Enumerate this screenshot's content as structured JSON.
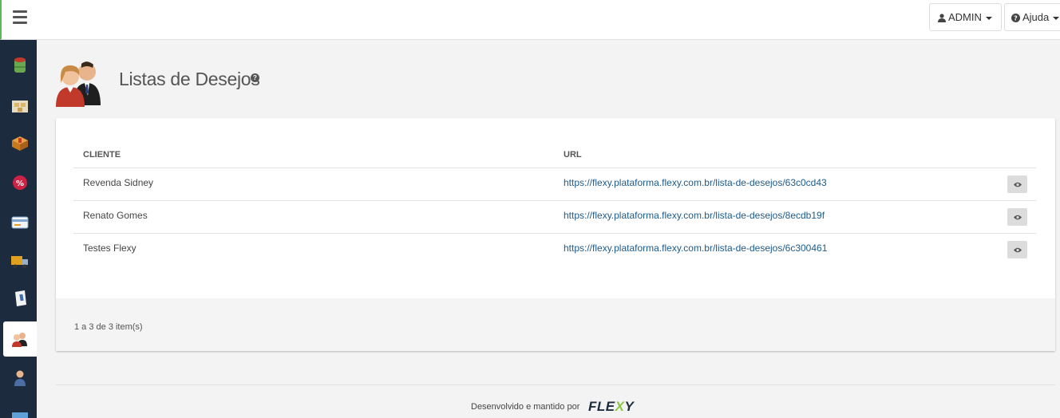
{
  "header": {
    "user_label": "ADMIN",
    "help_label": "Ajuda"
  },
  "sidebar": {
    "items": [
      {
        "icon": "database-icon",
        "color": "#6aa84f"
      },
      {
        "icon": "boxes-icon",
        "color": "#d9b66a"
      },
      {
        "icon": "package-icon",
        "color": "#d08a2c"
      },
      {
        "icon": "discount-icon",
        "color": "#cc2244"
      },
      {
        "icon": "card-icon",
        "color": "#7fa8d0"
      },
      {
        "icon": "truck-icon",
        "color": "#e0a020"
      },
      {
        "icon": "note-icon",
        "color": "#e8e8e8"
      },
      {
        "icon": "users-icon",
        "color": "#c0392b",
        "active": true
      },
      {
        "icon": "person-icon",
        "color": "#4a6fa5"
      },
      {
        "icon": "image-icon",
        "color": "#5fa0d8"
      }
    ]
  },
  "page": {
    "title": "Listas de Desejos"
  },
  "table": {
    "columns": [
      "CLIENTE",
      "URL"
    ],
    "rows": [
      {
        "cliente": "Revenda Sidney",
        "url": "https://flexy.plataforma.flexy.com.br/lista-de-desejos/63c0cd43"
      },
      {
        "cliente": "Renato Gomes",
        "url": "https://flexy.plataforma.flexy.com.br/lista-de-desejos/8ecdb19f"
      },
      {
        "cliente": "Testes Flexy",
        "url": "https://flexy.plataforma.flexy.com.br/lista-de-desejos/6c300461"
      }
    ],
    "footer_count": "1 a 3 de 3 item(s)"
  },
  "footer": {
    "credit": "Desenvolvido e mantido por",
    "brand_a": "FLE",
    "brand_x": "X",
    "brand_b": "Y"
  },
  "colors": {
    "sidebar_bg": "#1c2b3d",
    "link": "#1d5b8c",
    "accent": "#8dc63f"
  }
}
